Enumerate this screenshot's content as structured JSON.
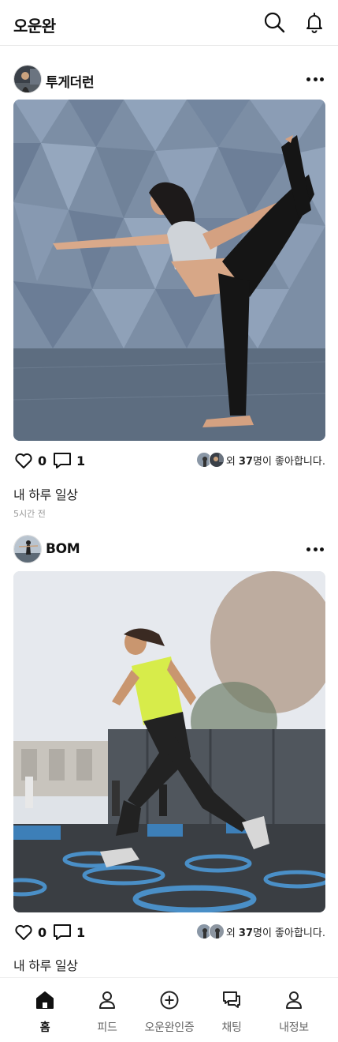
{
  "header": {
    "title": "오운완",
    "search_icon": "search-icon",
    "bell_icon": "bell-icon"
  },
  "posts": [
    {
      "username": "투게더런",
      "like_count": "0",
      "comment_count": "1",
      "likes_prefix": "외 ",
      "likes_number": "37",
      "likes_suffix": "명이 좋아합니다.",
      "caption": "내 하루 일상",
      "time_ago": "5시간 전"
    },
    {
      "username": "BOM",
      "like_count": "0",
      "comment_count": "1",
      "likes_prefix": "외 ",
      "likes_number": "37",
      "likes_suffix": "명이 좋아합니다.",
      "caption": "내 하루 일상"
    }
  ],
  "bottom_nav": {
    "items": [
      {
        "label": "홈",
        "icon": "home-icon",
        "active": true
      },
      {
        "label": "피드",
        "icon": "user-icon",
        "active": false
      },
      {
        "label": "오운완인증",
        "icon": "plus-circle-icon",
        "active": false
      },
      {
        "label": "채팅",
        "icon": "chat-icon",
        "active": false
      },
      {
        "label": "내정보",
        "icon": "profile-icon",
        "active": false
      }
    ]
  },
  "colors": {
    "accent": "#111111",
    "muted": "#999999",
    "divider": "#e9e9e9"
  }
}
